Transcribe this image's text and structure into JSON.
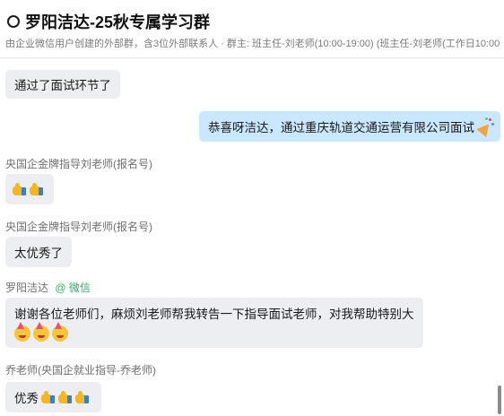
{
  "header": {
    "title": "罗阳洁达-25秋专属学习群",
    "subtitle": "由企业微信用户创建的外部群，含3位外部联系人 · 群主: 班主任-刘老师(10:00-19:00)  (班主任-刘老师(工作日10:00"
  },
  "messages": [
    {
      "text": "通过了面试环节了"
    },
    {
      "text": "恭喜呀洁达，通过重庆轨道交通运营有限公司面试"
    },
    {
      "sender": "央国企金牌指导刘老师(报名号)"
    },
    {
      "sender": "央国企金牌指导刘老师(报名号)",
      "text": "太优秀了"
    },
    {
      "sender": "罗阳洁达",
      "sender_tag": "@ 微信",
      "text": "谢谢各位老师们，麻烦刘老师帮我转告一下指导面试老师，对我帮助特别大"
    },
    {
      "sender": "乔老师(央国企就业指导-乔老师)",
      "text": "优秀"
    }
  ],
  "colors": {
    "self_bubble": "#c9e7ff",
    "other_bubble": "#eceef1",
    "wechat_tag": "#2aae67"
  },
  "icons": [
    "group-ring-icon",
    "thumbs-up-icon",
    "party-popper-icon",
    "partying-face-icon"
  ]
}
